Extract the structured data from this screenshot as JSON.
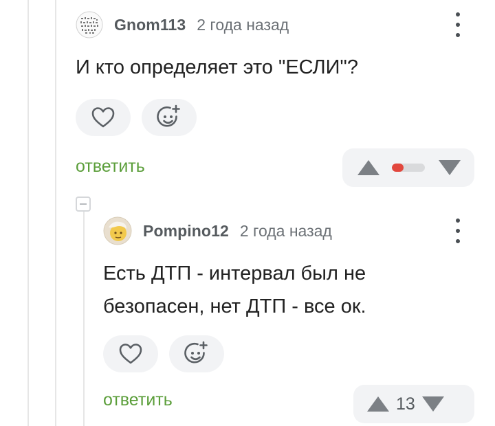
{
  "comments": [
    {
      "author": "Gnom113",
      "time": "2 года назад",
      "text": "И кто определяет это \"ЕСЛИ\"?",
      "reply_label": "ответить",
      "rating": {
        "shown": "bar",
        "negative_fraction": 0.35,
        "negative_color": "#e2473d"
      }
    },
    {
      "author": "Pompino12",
      "time": "2 года назад",
      "text": "Есть ДТП - интервал был не безопасен, нет ДТП - все ок.",
      "reply_label": "ответить",
      "rating": {
        "shown": "number",
        "score": "13"
      }
    }
  ],
  "colors": {
    "reply_link": "#5b9e3a",
    "vote_box_bg": "#f2f3f5",
    "arrow": "#7c8085",
    "thread_line": "#e6e6e6"
  },
  "icons": {
    "like": "heart-icon",
    "react": "smiley-plus-icon",
    "menu": "kebab-menu-icon",
    "vote_up": "triangle-up-icon",
    "vote_down": "triangle-down-icon",
    "collapse": "collapse-minus-icon"
  }
}
